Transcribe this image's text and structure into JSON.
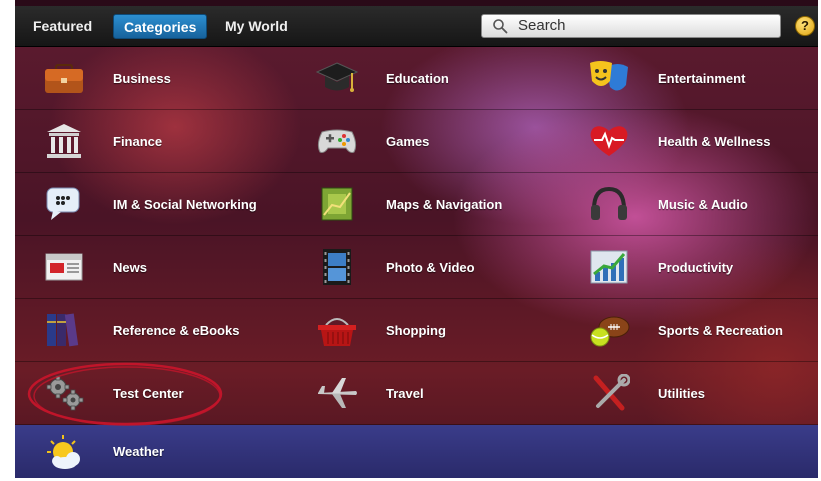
{
  "tabs": {
    "featured": "Featured",
    "categories": "Categories",
    "my_world": "My World"
  },
  "search": {
    "placeholder": "Search"
  },
  "help": {
    "label": "?"
  },
  "categories": [
    {
      "label": "Business",
      "icon": "briefcase-icon"
    },
    {
      "label": "Education",
      "icon": "graduation-cap-icon"
    },
    {
      "label": "Entertainment",
      "icon": "theater-masks-icon"
    },
    {
      "label": "Finance",
      "icon": "bank-icon"
    },
    {
      "label": "Games",
      "icon": "gamepad-icon"
    },
    {
      "label": "Health & Wellness",
      "icon": "heart-pulse-icon"
    },
    {
      "label": "IM & Social Networking",
      "icon": "chat-bubble-icon"
    },
    {
      "label": "Maps & Navigation",
      "icon": "map-icon"
    },
    {
      "label": "Music & Audio",
      "icon": "headphones-icon"
    },
    {
      "label": "News",
      "icon": "newspaper-icon"
    },
    {
      "label": "Photo & Video",
      "icon": "film-strip-icon"
    },
    {
      "label": "Productivity",
      "icon": "growth-chart-icon"
    },
    {
      "label": "Reference & eBooks",
      "icon": "books-icon"
    },
    {
      "label": "Shopping",
      "icon": "shopping-basket-icon"
    },
    {
      "label": "Sports & Recreation",
      "icon": "sports-balls-icon"
    },
    {
      "label": "Test Center",
      "icon": "gears-icon"
    },
    {
      "label": "Travel",
      "icon": "airplane-icon"
    },
    {
      "label": "Utilities",
      "icon": "wrench-screwdriver-icon"
    },
    {
      "label": "Weather",
      "icon": "sun-cloud-icon"
    }
  ],
  "colors": {
    "accent": "#1f7fc4",
    "annotation": "#c0152a",
    "help": "#f0b820"
  }
}
